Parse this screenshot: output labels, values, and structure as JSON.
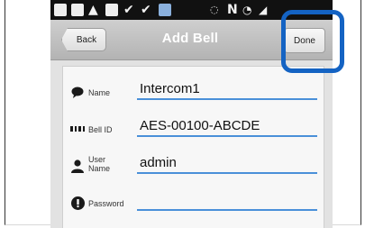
{
  "nav": {
    "back_label": "Back",
    "title": "Add Bell",
    "done_label": "Done"
  },
  "form": {
    "fields": [
      {
        "label": "Name",
        "value": "Intercom1",
        "icon": "chat-bubble-icon"
      },
      {
        "label": "Bell ID",
        "value": "AES-00100-ABCDE",
        "icon": "grid-icon"
      },
      {
        "label_line1": "User",
        "label_line2": "Name",
        "value": "admin",
        "icon": "person-icon"
      },
      {
        "label": "Password",
        "value": "",
        "icon": "key-icon"
      }
    ]
  },
  "status_bar": {
    "icons": [
      "add-box-icon",
      "image-icon",
      "warning-icon",
      "linkedin-icon",
      "check-icon",
      "check-icon",
      "app-icon",
      "vibrate-icon",
      "nfc-icon",
      "wifi-icon",
      "signal-icon"
    ]
  },
  "colors": {
    "highlight": "#1463c3",
    "field_underline": "#4a90d9",
    "nav_title": "#ffffff"
  }
}
